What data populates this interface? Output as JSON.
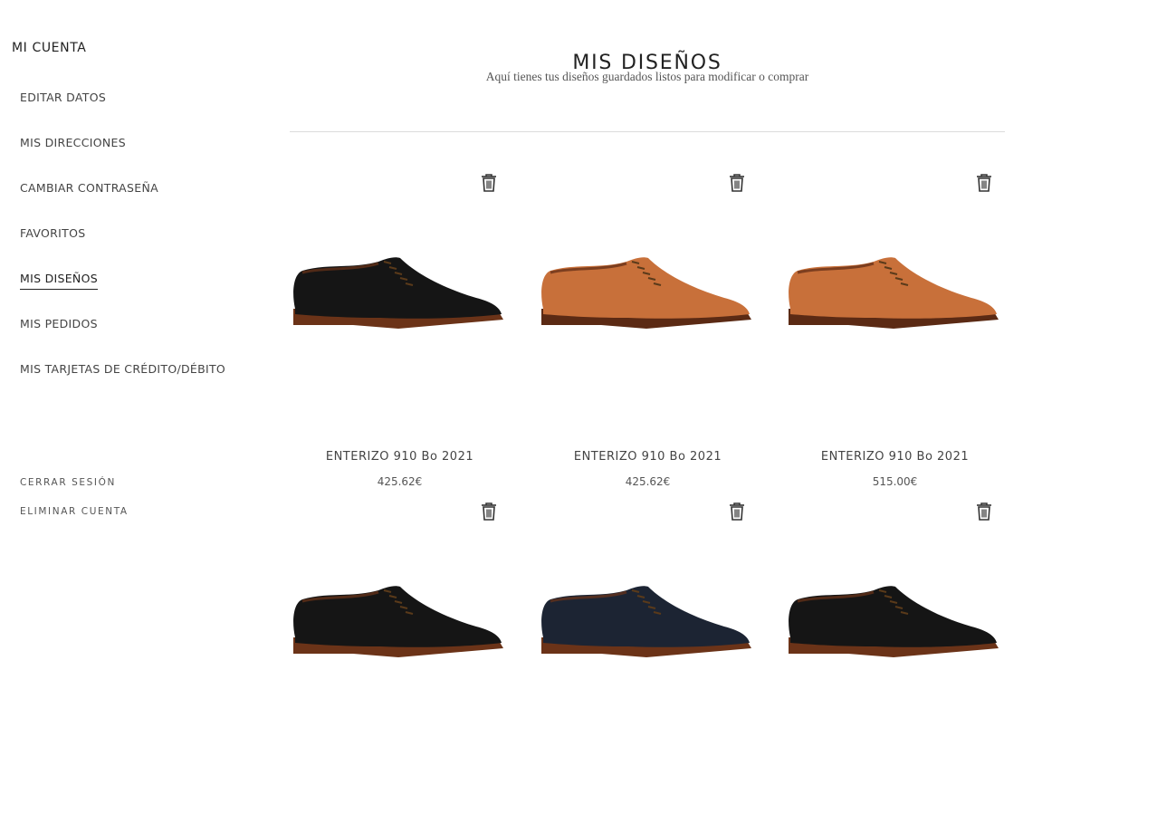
{
  "sidebar": {
    "title": "MI CUENTA",
    "items": [
      {
        "label": "EDITAR DATOS"
      },
      {
        "label": "MIS DIRECCIONES"
      },
      {
        "label": "CAMBIAR CONTRASEÑA"
      },
      {
        "label": "FAVORITOS"
      },
      {
        "label": "MIS DISEÑOS",
        "active": true
      },
      {
        "label": "MIS PEDIDOS"
      },
      {
        "label": "MIS TARJETAS DE CRÉDITO/DÉBITO"
      }
    ],
    "footer": {
      "logout": "CERRAR SESIÓN",
      "delete_account": "ELIMINAR CUENTA"
    }
  },
  "main": {
    "title": "MIS DISEÑOS",
    "subtitle": "Aquí tienes tus diseños guardados listos para modificar o comprar"
  },
  "designs": [
    {
      "name": "ENTERIZO 910 Bo 2021",
      "price": "425.62€",
      "color": "black",
      "upper": "#151515",
      "sole": "#6b3318"
    },
    {
      "name": "ENTERIZO 910 Bo 2021",
      "price": "425.62€",
      "color": "tan",
      "upper": "#c8703a",
      "sole": "#5b2a14"
    },
    {
      "name": "ENTERIZO 910 Bo 2021",
      "price": "515.00€",
      "color": "tan",
      "upper": "#c8703a",
      "sole": "#5b2a14"
    },
    {
      "color": "black",
      "upper": "#151515",
      "sole": "#6b3318"
    },
    {
      "color": "navy",
      "upper": "#1c2433",
      "sole": "#6b3318"
    },
    {
      "color": "black",
      "upper": "#151515",
      "sole": "#6b3318"
    }
  ]
}
